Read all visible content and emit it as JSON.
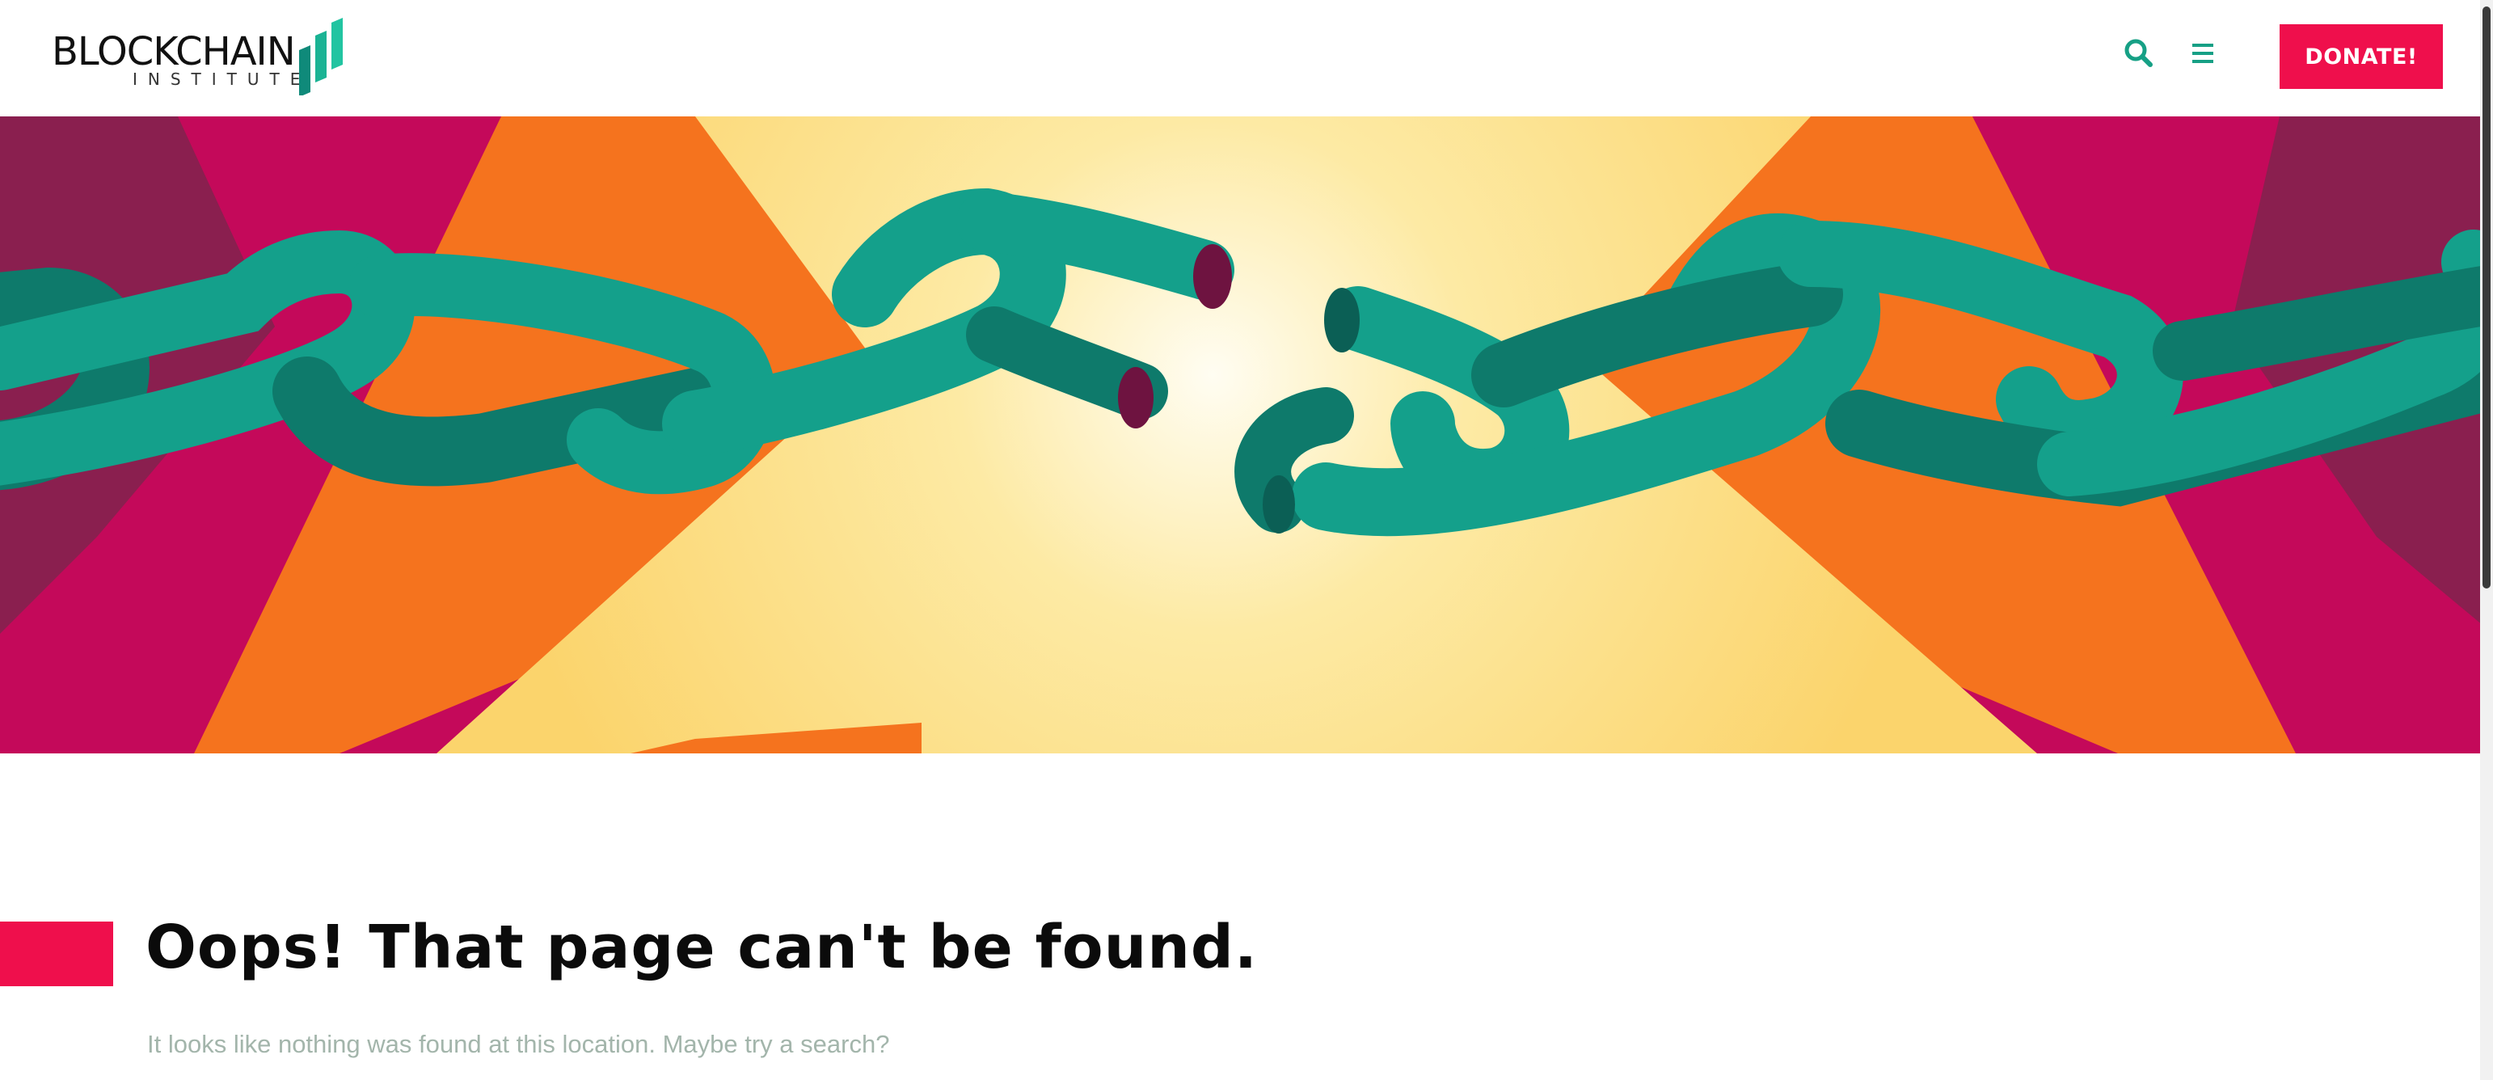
{
  "header": {
    "logo": {
      "wordmark": "BLOCKCHAIN",
      "subtitle": "INSTITUTE",
      "name": "Blockchain Institute logo"
    },
    "icons": {
      "search": "search-icon",
      "menu": "hamburger-menu-icon"
    },
    "donate_label": "DONATE!"
  },
  "hero": {
    "image": "broken-chain-illustration",
    "colors": {
      "magenta": "#c4095a",
      "orange": "#f5731e",
      "yellow": "#fcd977",
      "teal": "#139a86",
      "teal_dark": "#0b6e62"
    }
  },
  "content": {
    "title": "Oops! That page can't be found.",
    "message": "It looks like nothing was found at this location. Maybe try a search?"
  },
  "colors": {
    "accent": "#ef0f4c",
    "brand_teal": "#16a085",
    "message_text": "#a3b5ab"
  }
}
